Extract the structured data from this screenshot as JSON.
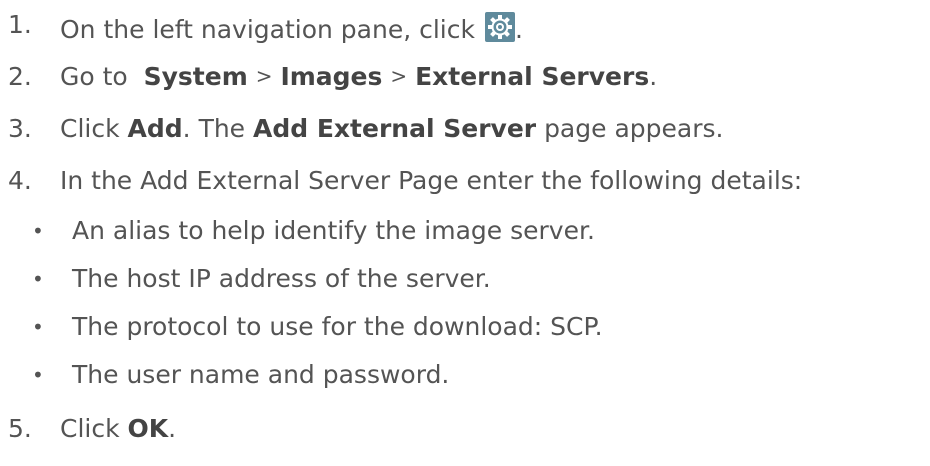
{
  "steps": [
    {
      "num": "1.",
      "text_before": "On the left navigation pane, click",
      "icon": "gear-icon",
      "text_after": "."
    },
    {
      "num": "2.",
      "text_before": "Go to",
      "path": [
        "System",
        "Images",
        "External Servers"
      ],
      "separator": ">",
      "text_after": "."
    },
    {
      "num": "3.",
      "text_before": "Click",
      "bold1": "Add",
      "text_mid": ". The",
      "bold2": "Add External Server",
      "text_after": "page appears."
    },
    {
      "num": "4.",
      "text": "In the Add External Server Page enter the following details:"
    },
    {
      "num": "5.",
      "text_before": "Click",
      "bold": "OK",
      "text_after": "."
    }
  ],
  "bullets": [
    "An alias to help identify the image server.",
    "The host IP address of the server.",
    "The protocol to use for the download: SCP.",
    "The user name and password."
  ],
  "bullet_glyph": "•",
  "colors": {
    "text": "#545454",
    "icon_bg": "#5f8a9c",
    "icon_fg": "#ffffff"
  }
}
